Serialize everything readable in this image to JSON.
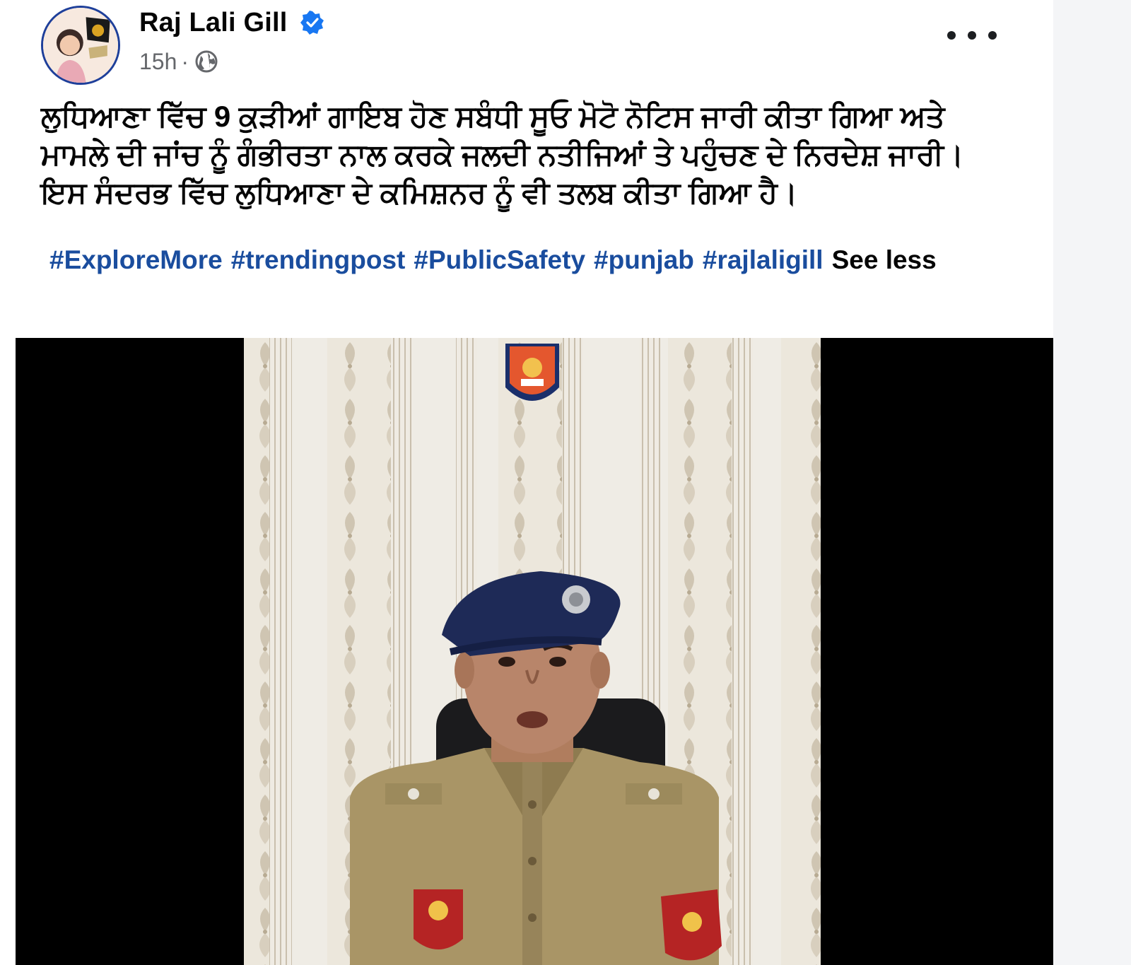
{
  "post": {
    "author": "Raj Lali Gill",
    "time": "15h",
    "separator": "·",
    "lines": [
      "ਲੁਧਿਆਣਾ ਵਿੱਚ 9 ਕੁੜੀਆਂ ਗਾਇਬ ਹੋਣ ਸਬੰਧੀ ਸੂਓ ਮੋਟੋ ਨੋਟਿਸ ਜਾਰੀ ਕੀਤਾ ਗਿਆ ਅਤੇ",
      "ਮਾਮਲੇ ਦੀ ਜਾਂਚ ਨੂੰ ਗੰਭੀਰਤਾ ਨਾਲ ਕਰਕੇ ਜਲਦੀ ਨਤੀਜਿਆਂ ਤੇ ਪਹੁੰਚਣ ਦੇ ਨਿਰਦੇਸ਼ ਜਾਰੀ।",
      "ਇਸ ਸੰਦਰਭ ਵਿੱਚ ਲੁਧਿਆਣਾ ਦੇ ਕਮਿਸ਼ਨਰ ਨੂੰ ਵੀ ਤਲਬ ਕੀਤਾ ਗਿਆ ਹੈ।"
    ],
    "hashtags": [
      "#ExploreMore",
      "#trendingpost",
      "#PublicSafety",
      "#punjab",
      "#rajlaligill"
    ],
    "see_less": "See less"
  },
  "icons": {
    "verified": "verified-badge-icon",
    "privacy": "globe-icon",
    "more": "more-options-icon"
  },
  "colors": {
    "hashtag": "#1a4d9e",
    "verified": "#1877f2",
    "meta": "#65676b",
    "text": "#050505"
  }
}
